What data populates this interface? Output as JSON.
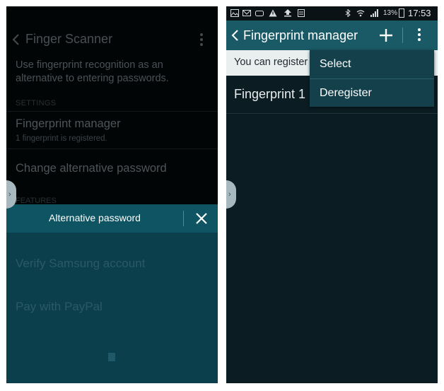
{
  "left_screen": {
    "header": {
      "title": "Finger Scanner",
      "back_icon": "chevron-left-icon",
      "more_icon": "more-vertical-icon"
    },
    "description": "Use fingerprint recognition as an alternative to entering passwords.",
    "section_settings": "SETTINGS",
    "items": [
      {
        "title": "Fingerprint manager",
        "subtitle": "1 fingerprint is registered."
      },
      {
        "title": "Change alternative password"
      }
    ],
    "section_features": "FEATURES",
    "dialog": {
      "title": "Alternative password",
      "close_icon": "close-icon"
    },
    "background_items": [
      {
        "title": "Verify Samsung account"
      },
      {
        "title": "Pay with PayPal"
      }
    ]
  },
  "right_screen": {
    "status_bar": {
      "battery": "13%",
      "time": "17:53"
    },
    "action_bar": {
      "title": "Fingerprint manager",
      "add_icon": "plus-icon",
      "more_icon": "more-vertical-icon"
    },
    "info_text": "You can register",
    "fingerprints": [
      "Fingerprint 1"
    ],
    "menu": [
      "Select",
      "Deregister"
    ]
  },
  "colors": {
    "accent": "#1a5a66",
    "dialog_bar": "#0e5462",
    "dark_background": "#0b1c22"
  }
}
